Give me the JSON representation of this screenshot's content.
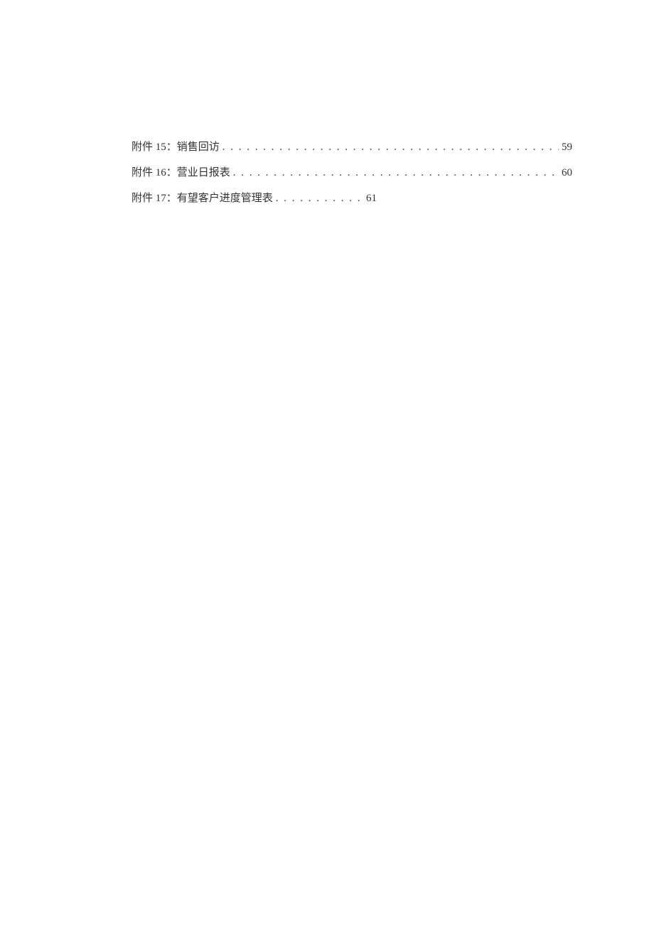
{
  "toc": {
    "entries": [
      {
        "label": "附件 15：销售回访",
        "page": "59",
        "short": false
      },
      {
        "label": "附件 16：营业日报表",
        "page": "60",
        "short": false
      },
      {
        "label": "附件 17：有望客户进度管理表",
        "page": "61",
        "short": true
      }
    ]
  }
}
